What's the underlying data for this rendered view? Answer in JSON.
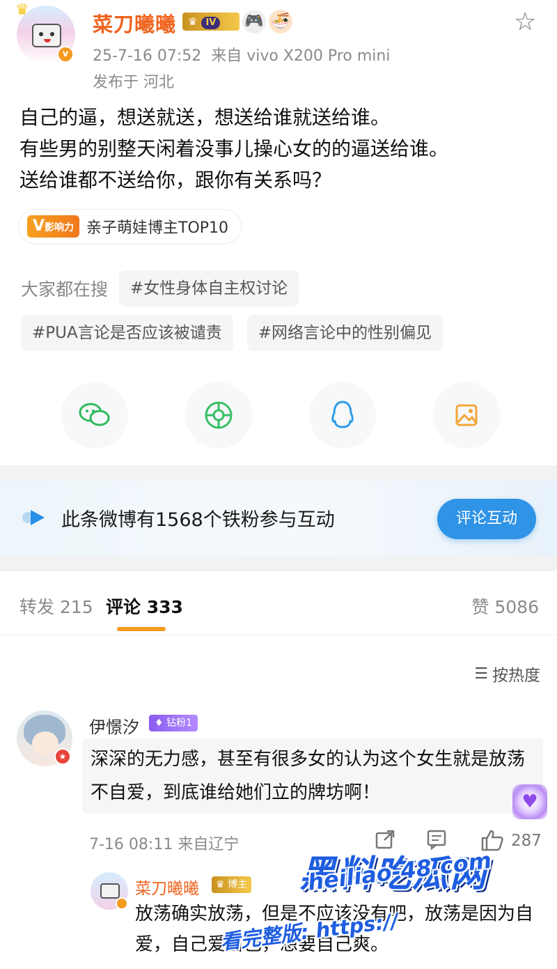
{
  "post": {
    "username": "菜刀曦曦",
    "level_badge_icon": "crown-icon",
    "level_badge": "IV",
    "timestamp": "25-7-16 07:52",
    "source": "来自 vivo X200 Pro mini",
    "location": "发布于 河北",
    "body_lines": [
      "自己的逼，想送就送，想送给谁就送给谁。",
      "有些男的别整天闲着没事儿操心女的的逼送给谁。",
      "送给谁都不送给你，跟你有关系吗？"
    ],
    "influence_tag": "影响力",
    "influence_text": "亲子萌娃博主TOP10"
  },
  "search": {
    "label": "大家都在搜",
    "tags": [
      "#女性身体自主权讨论",
      "#PUA言论是否应该被谴责",
      "#网络言论中的性别偏见"
    ]
  },
  "share": {
    "icons": [
      "wechat-icon",
      "moments-icon",
      "qq-icon",
      "album-icon"
    ]
  },
  "fans": {
    "text": "此条微博有1568个铁粉参与互动",
    "button": "评论互动"
  },
  "tabs": {
    "repost": "转发 215",
    "comments": "评论 333",
    "likes": "赞 5086"
  },
  "sort": {
    "label": "按热度"
  },
  "comment": {
    "username": "伊憬汐",
    "badge": "钻粉1",
    "body": "深深的无力感，甚至有很多女的认为这个女生就是放荡不自爱，到底谁给她们立的牌坊啊！",
    "meta": "7-16 08:11 来自辽宁",
    "likes": "287"
  },
  "reply": {
    "username": "菜刀曦曦",
    "badge": "博主",
    "body": "放荡确实放荡，但是不应该没有吧，放荡是因为自爱，自己爱自己，想要自己爽。"
  },
  "watermark": {
    "title": "黑料吃瓜网",
    "url": "heiliao-48.com",
    "label": "看完整版: https://"
  },
  "colors": {
    "accent_orange": "#f0641f",
    "accent_blue": "#2f93e6",
    "tab_underline": "#f39a1e"
  }
}
